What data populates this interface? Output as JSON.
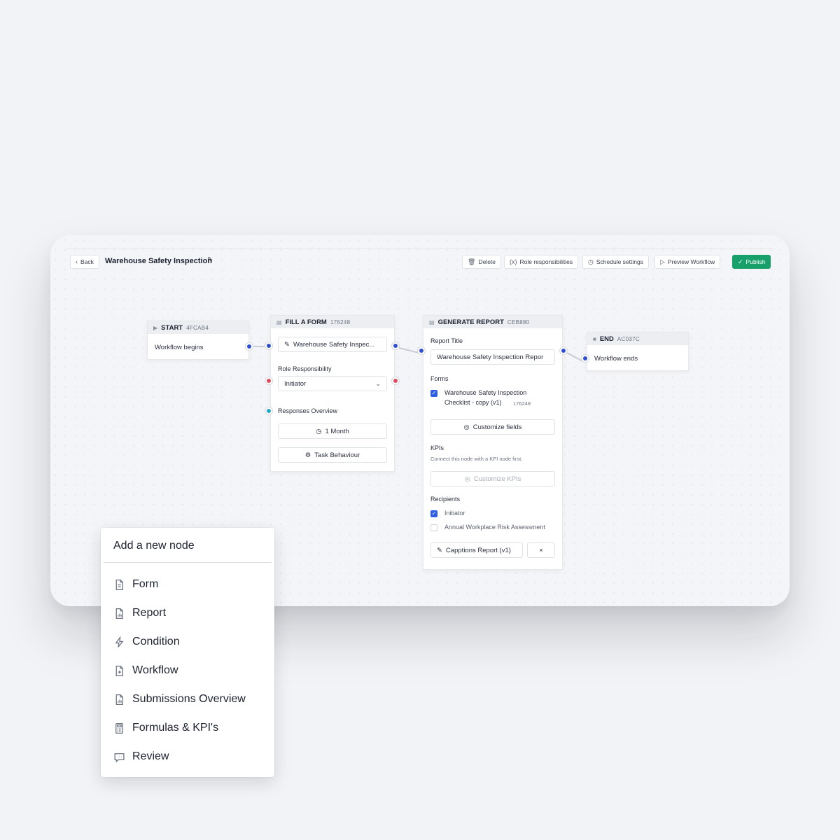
{
  "toolbar": {
    "back_label": "Back",
    "title": "Warehouse Safety Inspection",
    "delete_label": "Delete",
    "role_label": "Role responsibilities",
    "schedule_label": "Schedule settings",
    "preview_label": "Preview Workflow",
    "publish_label": "Publish"
  },
  "nodes": {
    "start": {
      "title": "START",
      "code": "4FCAB4",
      "text": "Workflow begins"
    },
    "form": {
      "title": "FILL A FORM",
      "code": "176248",
      "form_value": "Warehouse Safety Inspec...",
      "role_label": "Role Responsibility",
      "role_value": "Initiator",
      "responses_label": "Responses Overview",
      "period_value": "1 Month",
      "task_label": "Task Behaviour"
    },
    "report": {
      "title": "GENERATE REPORT",
      "code": "CEB880",
      "report_title_label": "Report Title",
      "report_title_value": "Warehouse Safety Inspection Repor",
      "forms_label": "Forms",
      "form_item_line1": "Warehouse Safety Inspection",
      "form_item_line2": "Checklist - copy (v1)",
      "form_item_code": "176248",
      "customize_fields_label": "Customize fields",
      "kpis_label": "KPIs",
      "kpis_hint": "Connect this node with a KPI node first.",
      "customize_kpis_label": "Customize KPIs",
      "recipients_label": "Recipients",
      "recipient_1": "Initiator",
      "recipient_2": "Annual Workplace Risk Assessment",
      "template_label": "Capptions Report (v1)",
      "close_label": "×"
    },
    "end": {
      "title": "END",
      "code": "AC037C",
      "text": "Workflow ends"
    }
  },
  "popup": {
    "title": "Add a new node",
    "items": [
      {
        "label": "Form",
        "icon": "file-icon"
      },
      {
        "label": "Report",
        "icon": "report-icon"
      },
      {
        "label": "Condition",
        "icon": "lightning-icon"
      },
      {
        "label": "Workflow",
        "icon": "file-plus-icon"
      },
      {
        "label": "Submissions Overview",
        "icon": "report-icon"
      },
      {
        "label": "Formulas & KPI's",
        "icon": "calculator-icon"
      },
      {
        "label": "Review",
        "icon": "chat-icon"
      }
    ]
  },
  "colors": {
    "publish": "#18a06a",
    "connector": "#2f4fd1",
    "checkbox": "#2f5ee6"
  }
}
